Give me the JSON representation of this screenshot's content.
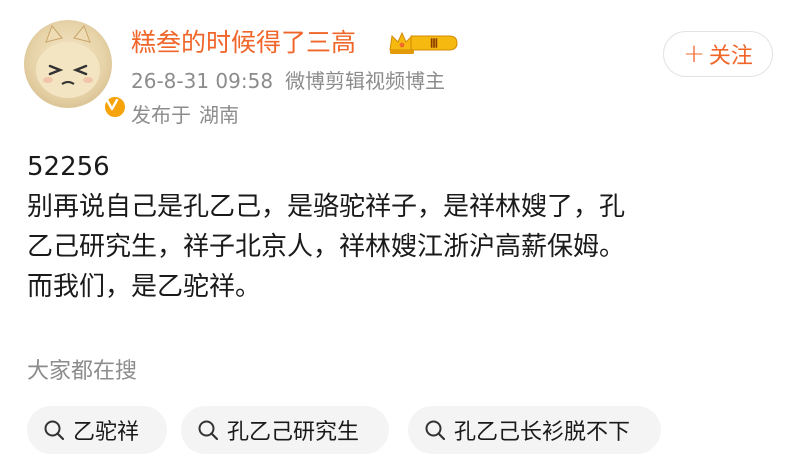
{
  "header": {
    "username": "糕叁的时候得了三高",
    "member_level": "Ⅲ",
    "time": "26-8-31 09:58",
    "source": "微博剪辑视频博主",
    "location_prefix": "发布于",
    "location": "湖南",
    "follow": {
      "plus": "+",
      "label": "关注"
    }
  },
  "post": {
    "lines": [
      "52256",
      "别再说自己是孔乙己，是骆驼祥子，是祥林嫂了，孔",
      "乙己研究生，祥子北京人，祥林嫂江浙沪高薪保姆。",
      "而我们，是乙驼祥。"
    ]
  },
  "search": {
    "title": "大家都在搜",
    "chips": [
      "乙驼祥",
      "孔乙己研究生",
      "孔乙己长衫脱不下"
    ]
  },
  "colors": {
    "accent": "#f0662a",
    "meta_text": "#8c8c8c",
    "badge_gold": "#f7a30a",
    "chip_bg": "#f4f4f4"
  },
  "icons": [
    "avatar-cartoon-cat",
    "verified-v-icon",
    "crown-member-icon",
    "plus-icon",
    "search-icon"
  ]
}
